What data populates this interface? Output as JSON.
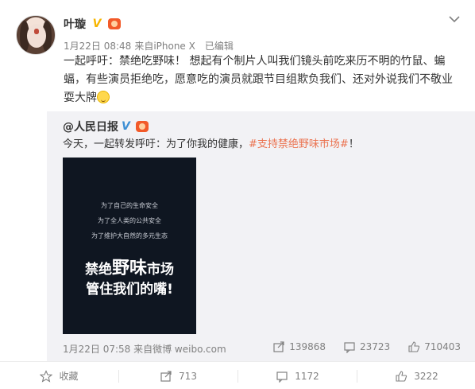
{
  "post": {
    "author_name": "叶璇",
    "meta_time": "1月22日 08:48",
    "meta_source": "来自iPhone X",
    "meta_edited": "已编辑",
    "body_text": "一起呼吁：禁绝吃野味！ 想起有个制片人叫我们镜头前吃来历不明的竹鼠、蝙蝠，有些演员拒绝吃，愿意吃的演员就跟节目组欺负我们、还对外说我们不敬业耍大牌"
  },
  "repost": {
    "author_name": "@人民日报",
    "text_prefix": "今天，一起转发呼吁：为了你我的健康，",
    "hashtag": "#支持禁绝野味市场#",
    "text_suffix": "！",
    "image": {
      "line1": "为了自己的生命安全",
      "line2": "为了全人类的公共安全",
      "line3": "为了维护大自然的多元生态",
      "big1_pre": "禁绝",
      "big1_hl": "野味",
      "big1_post": "市场",
      "big2": "管住我们的嘴!"
    },
    "meta": "1月22日 07:58 来自微博 weibo.com",
    "reposts": "139868",
    "comments": "23723",
    "likes": "710403"
  },
  "actions": {
    "collect_label": "收藏",
    "repost_count": "713",
    "comment_count": "1172",
    "like_count": "3222"
  },
  "colors": {
    "hashtag": "#eb7350",
    "verified_gold": "#f7b500",
    "verified_blue": "#3d8fd4",
    "repost_bg": "#f2f2f5"
  },
  "icons": [
    "chevron-down-icon",
    "verified-icon",
    "member-icon",
    "emoji-icon",
    "star-icon",
    "repost-icon",
    "comment-icon",
    "like-icon"
  ]
}
